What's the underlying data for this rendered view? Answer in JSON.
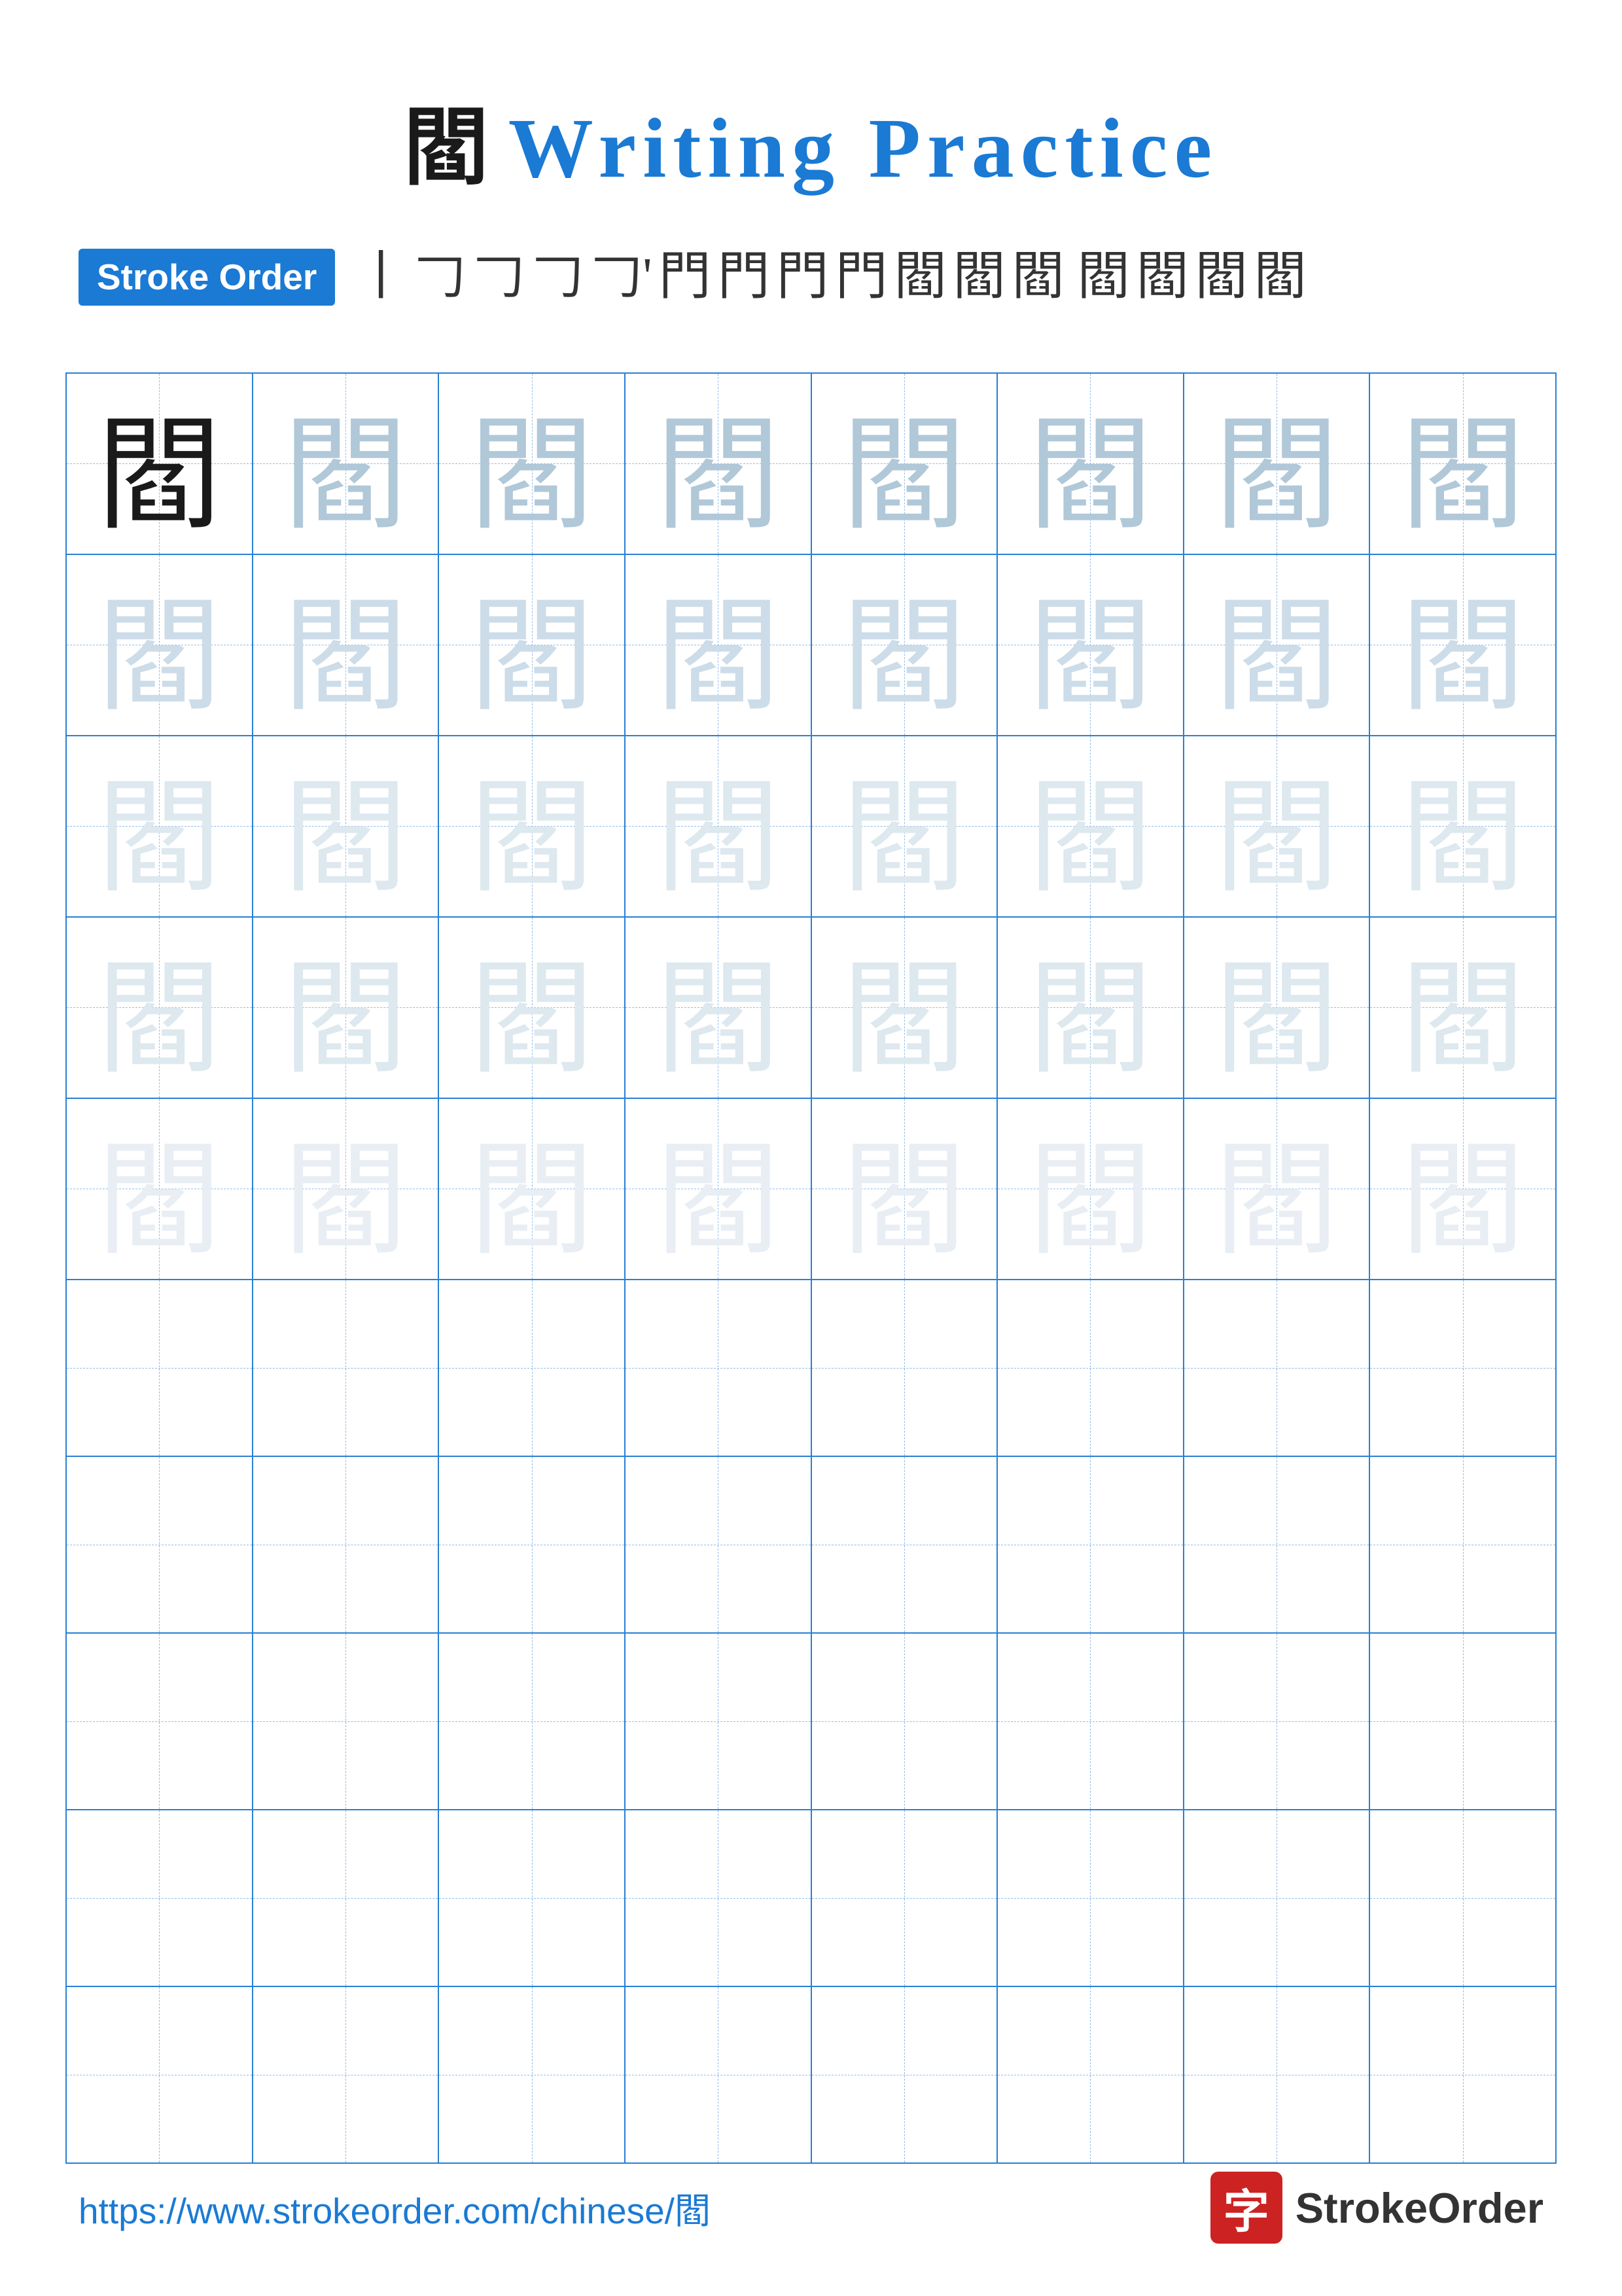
{
  "title": {
    "char": "閻",
    "text": "Writing Practice",
    "color_char": "#1a1a1a",
    "color_text": "#1a7ad4"
  },
  "stroke_order": {
    "badge_label": "Stroke Order",
    "steps": [
      "丨",
      "𠃌",
      "𠃌",
      "𠃌",
      "𠃌'",
      "門",
      "門",
      "門",
      "門",
      "閻",
      "閻",
      "閻",
      "閻",
      "閻",
      "閻",
      "閻"
    ]
  },
  "practice": {
    "char": "閻",
    "rows": 10,
    "cols": 8
  },
  "footer": {
    "url": "https://www.strokeorder.com/chinese/閻",
    "logo_char": "字",
    "logo_text": "StrokeOrder"
  }
}
